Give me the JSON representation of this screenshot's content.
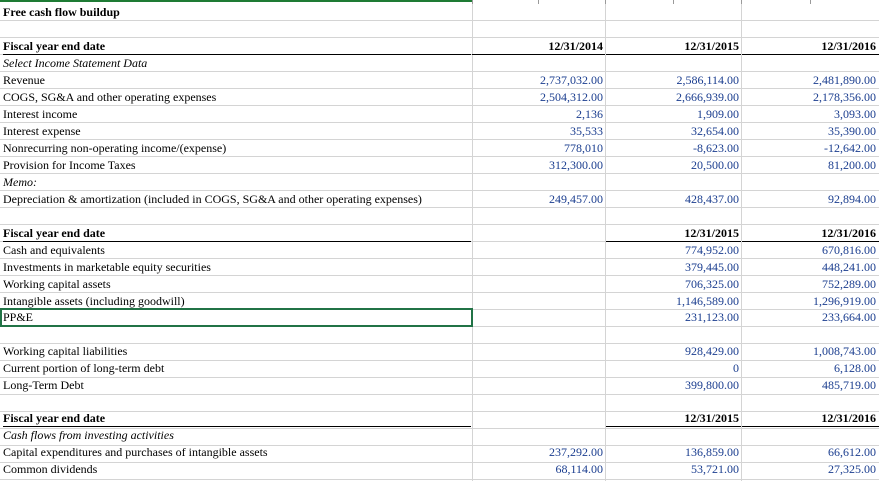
{
  "title": "Free cash flow buildup",
  "sections": [
    {
      "header": {
        "label": "Fiscal year end date",
        "c1": "12/31/2014",
        "c2": "12/31/2015",
        "c3": "12/31/2016"
      },
      "rows": [
        {
          "label": "Select Income Statement Data",
          "style": "italic"
        },
        {
          "label": "Revenue",
          "c1": "2,737,032.00",
          "c2": "2,586,114.00",
          "c3": "2,481,890.00"
        },
        {
          "label": "COGS, SG&A and other operating expenses",
          "c1": "2,504,312.00",
          "c2": "2,666,939.00",
          "c3": "2,178,356.00"
        },
        {
          "label": "Interest income",
          "c1": "2,136",
          "c2": "1,909.00",
          "c3": "3,093.00"
        },
        {
          "label": "Interest expense",
          "c1": "35,533",
          "c2": "32,654.00",
          "c3": "35,390.00"
        },
        {
          "label": "Nonrecurring non-operating income/(expense)",
          "c1": "778,010",
          "c2": "-8,623.00",
          "c3": "-12,642.00"
        },
        {
          "label": "Provision for Income Taxes",
          "c1": "312,300.00",
          "c2": "20,500.00",
          "c3": "81,200.00"
        },
        {
          "label": "Memo:",
          "style": "italic"
        },
        {
          "label": "Depreciation & amortization (included in COGS, SG&A and other operating expenses)",
          "c1": "249,457.00",
          "c2": "428,437.00",
          "c3": "92,894.00"
        }
      ]
    },
    {
      "header": {
        "label": "Fiscal year end date",
        "c1": "",
        "c2": "12/31/2015",
        "c3": "12/31/2016"
      },
      "rows": [
        {
          "label": "Cash and equivalents",
          "c2": "774,952.00",
          "c3": "670,816.00"
        },
        {
          "label": "Investments in marketable equity securities",
          "c2": "379,445.00",
          "c3": "448,241.00"
        },
        {
          "label": "Working capital assets",
          "c2": "706,325.00",
          "c3": "752,289.00"
        },
        {
          "label": "Intangible assets (including goodwill)",
          "c2": "1,146,589.00",
          "c3": "1,296,919.00"
        },
        {
          "label": "PP&E",
          "c2": "231,123.00",
          "c3": "233,664.00"
        }
      ]
    },
    {
      "rows": [
        {
          "label": "Working capital liabilities",
          "c2": "928,429.00",
          "c3": "1,008,743.00"
        },
        {
          "label": "Current portion of long-term debt",
          "c2": "0",
          "c3": "6,128.00"
        },
        {
          "label": "Long-Term Debt",
          "c2": "399,800.00",
          "c3": "485,719.00"
        }
      ]
    },
    {
      "header": {
        "label": "Fiscal year end date",
        "c1": "",
        "c2": "12/31/2015",
        "c3": "12/31/2016"
      },
      "rows": [
        {
          "label": "Cash flows from investing activities",
          "style": "italic"
        },
        {
          "label": "Capital expenditures and purchases of intangible assets",
          "c1": "237,292.00",
          "c2": "136,859.00",
          "c3": "66,612.00"
        },
        {
          "label": "Common dividends",
          "c1": "68,114.00",
          "c2": "53,721.00",
          "c3": "27,325.00"
        }
      ]
    }
  ]
}
